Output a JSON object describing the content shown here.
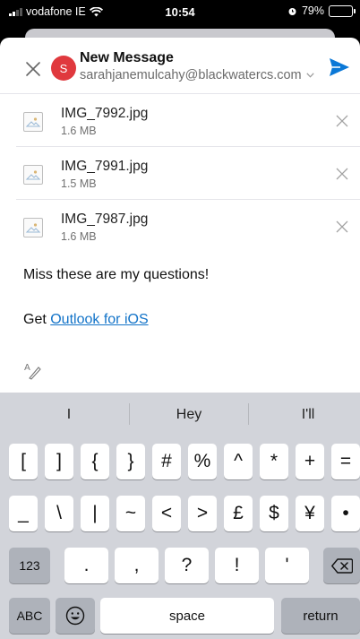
{
  "status_bar": {
    "carrier": "vodafone IE",
    "time": "10:54",
    "battery": "79%",
    "battery_level": 0.79
  },
  "compose": {
    "title": "New Message",
    "avatar_initial": "S",
    "from": "sarahjanemulcahy@blackwatercs.com",
    "accent": "#0a78d7",
    "avatar_color": "#e0393e"
  },
  "attachments": [
    {
      "name": "IMG_7992.jpg",
      "size": "1.6 MB"
    },
    {
      "name": "IMG_7991.jpg",
      "size": "1.5 MB"
    },
    {
      "name": "IMG_7987.jpg",
      "size": "1.6 MB"
    }
  ],
  "body": {
    "line1": "Miss these are my questions!",
    "sig_prefix": "Get ",
    "sig_link": "Outlook for iOS"
  },
  "keyboard": {
    "suggestions": [
      "I",
      "Hey",
      "I'll"
    ],
    "row1": [
      "[",
      "]",
      "{",
      "}",
      "#",
      "%",
      "^",
      "*",
      "+",
      "="
    ],
    "row2": [
      "_",
      "\\",
      "|",
      "~",
      "<",
      ">",
      "£",
      "$",
      "¥",
      "•"
    ],
    "row3_left": "123",
    "row3": [
      ".",
      ",",
      "?",
      "!",
      "'"
    ],
    "abc": "ABC",
    "space": "space",
    "return": "return"
  }
}
